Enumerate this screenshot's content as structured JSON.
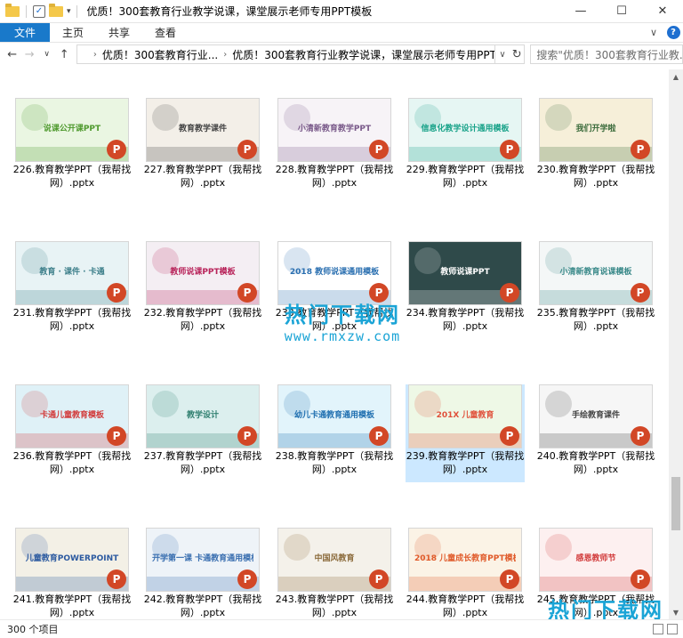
{
  "window": {
    "title": "优质！300套教育行业教学说课，课堂展示老师专用PPT模板",
    "minimize": "—",
    "maximize": "☐",
    "close": "✕"
  },
  "ribbon": {
    "tabs": [
      "文件",
      "主页",
      "共享",
      "查看"
    ],
    "expand": "∨",
    "help": "?"
  },
  "address": {
    "crumbs": [
      "优质！300套教育行业...",
      "优质！300套教育行业教学说课，课堂展示老师专用PPT模板"
    ],
    "search_placeholder": "搜索\"优质！300套教育行业教..."
  },
  "files": [
    {
      "name": "226.教育教学PPT（我帮找网）.pptx",
      "thumb": "说课公开课PPT",
      "bg": "#eaf6e2",
      "fg": "#4f9a2e"
    },
    {
      "name": "227.教育教学PPT（我帮找网）.pptx",
      "thumb": "教育教学课件",
      "bg": "#f3efe8",
      "fg": "#444444"
    },
    {
      "name": "228.教育教学PPT（我帮找网）.pptx",
      "thumb": "小清新教育教学PPT",
      "bg": "#f7f3f7",
      "fg": "#7a5a8a"
    },
    {
      "name": "229.教育教学PPT（我帮找网）.pptx",
      "thumb": "信息化教学设计通用模板",
      "bg": "#e6f6f3",
      "fg": "#1aa38a"
    },
    {
      "name": "230.教育教学PPT（我帮找网）.pptx",
      "thumb": "我们开学啦",
      "bg": "#f6efd9",
      "fg": "#3b6b3b"
    },
    {
      "name": "231.教育教学PPT（我帮找网）.pptx",
      "thumb": "教育 · 课件 · 卡通",
      "bg": "#e8f3f5",
      "fg": "#3d7f8a"
    },
    {
      "name": "232.教育教学PPT（我帮找网）.pptx",
      "thumb": "教师说课PPT模板",
      "bg": "#f4eef3",
      "fg": "#b8235a"
    },
    {
      "name": "233.教育教学PPT（我帮找网）.pptx",
      "thumb": "2018 教师说课通用模板",
      "bg": "#ffffff",
      "fg": "#2a6fb0"
    },
    {
      "name": "234.教育教学PPT（我帮找网）.pptx",
      "thumb": "教师说课PPT",
      "bg": "#2f4a4a",
      "fg": "#ffffff"
    },
    {
      "name": "235.教育教学PPT（我帮找网）.pptx",
      "thumb": "小清新教育说课模板",
      "bg": "#f4f7f7",
      "fg": "#3b8a8a"
    },
    {
      "name": "236.教育教学PPT（我帮找网）.pptx",
      "thumb": "卡通儿童教育模板",
      "bg": "#dff1f7",
      "fg": "#d23b3b"
    },
    {
      "name": "237.教育教学PPT（我帮找网）.pptx",
      "thumb": "教学设计",
      "bg": "#dcefee",
      "fg": "#2f7f6f"
    },
    {
      "name": "238.教育教学PPT（我帮找网）.pptx",
      "thumb": "幼儿卡通教育通用模板",
      "bg": "#e2f4fb",
      "fg": "#1f6fb0"
    },
    {
      "name": "239.教育教学PPT（我帮找网）.pptx",
      "thumb": "201X 儿童教育",
      "bg": "#eef8e6",
      "fg": "#e0503a"
    },
    {
      "name": "240.教育教学PPT（我帮找网）.pptx",
      "thumb": "手绘教育课件",
      "bg": "#f6f6f6",
      "fg": "#444444"
    },
    {
      "name": "241.教育教学PPT（我帮找网）.pptx",
      "thumb": "儿童教育POWERPOINT",
      "bg": "#f3f0e6",
      "fg": "#2c5aa0"
    },
    {
      "name": "242.教育教学PPT（我帮找网）.pptx",
      "thumb": "开学第一课 卡通教育通用模板",
      "bg": "#eef3f8",
      "fg": "#3a6fb0"
    },
    {
      "name": "243.教育教学PPT（我帮找网）.pptx",
      "thumb": "中国风教育",
      "bg": "#f4f1ea",
      "fg": "#8a6a3a"
    },
    {
      "name": "244.教育教学PPT（我帮找网）.pptx",
      "thumb": "2018 儿童成长教育PPT模板",
      "bg": "#fbf3e6",
      "fg": "#e05a2a"
    },
    {
      "name": "245.教育教学PPT（我帮找网）.pptx",
      "thumb": "感恩教师节",
      "bg": "#fdf0f0",
      "fg": "#d23b3b"
    }
  ],
  "file_icon_letter": "P",
  "status": {
    "count": "300 个项目"
  },
  "watermark": {
    "title": "热门下载网",
    "url": "www.rmxzw.com"
  },
  "scrollbar": {
    "up": "▲",
    "down": "▼"
  }
}
